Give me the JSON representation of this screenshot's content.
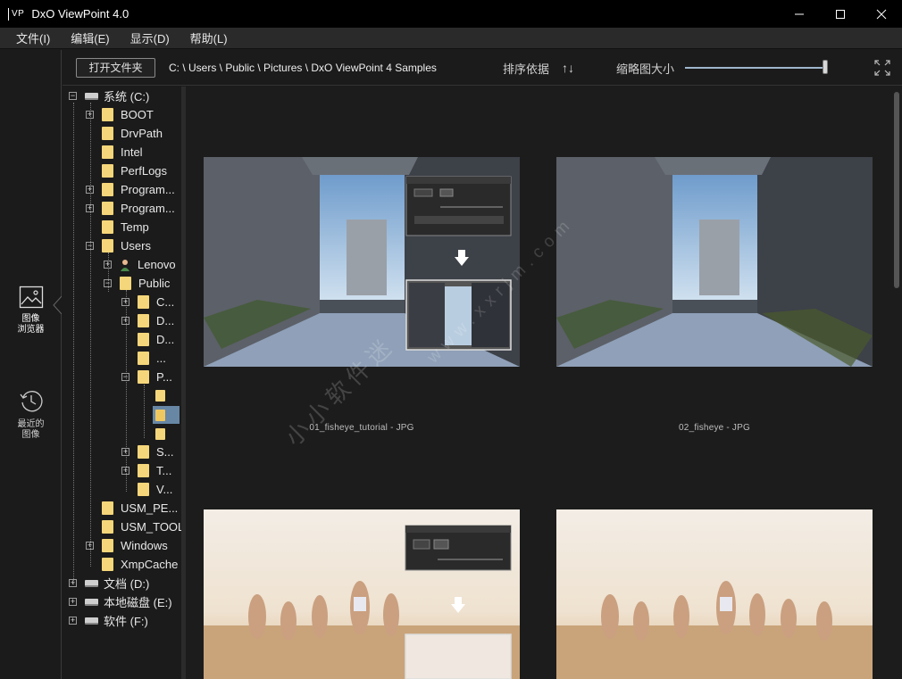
{
  "window": {
    "logo": "VP",
    "title": "DxO ViewPoint 4.0"
  },
  "menu": [
    "文件(I)",
    "编辑(E)",
    "显示(D)",
    "帮助(L)"
  ],
  "rail": {
    "browser_label_1": "图像",
    "browser_label_2": "浏览器",
    "recent_label_1": "最近的",
    "recent_label_2": "图像"
  },
  "toolbar": {
    "open_folder": "打开文件夹",
    "path": "C: \\ Users \\ Public \\ Pictures \\ DxO ViewPoint 4 Samples",
    "sort_label": "排序依据",
    "sort_icon": "↑↓",
    "thumb_size_label": "缩略图大小",
    "thumb_size_value": 1.0
  },
  "tree": {
    "root": "系统 (C:)",
    "items": [
      "BOOT",
      "DrvPath",
      "Intel",
      "PerfLogs",
      "Program...",
      "Program...",
      "Temp",
      "Users",
      "Lenovo",
      "Public",
      "C...",
      "D...",
      "D...",
      "...",
      "P...",
      "S...",
      "T...",
      "V...",
      "USM_PE...",
      "USM_TOOL",
      "Windows",
      "XmpCache"
    ],
    "drives": [
      "文档 (D:)",
      "本地磁盘 (E:)",
      "软件 (F:)"
    ]
  },
  "thumbs": [
    {
      "caption": "01_fisheye_tutorial - JPG"
    },
    {
      "caption": "02_fisheye - JPG"
    }
  ],
  "watermark": {
    "cn": "小小软件迷",
    "url": "www.xxrjm.com"
  },
  "colors": {
    "accent": "#9fb6cc",
    "selection": "#7aa3c8",
    "folder": "#f5d67a"
  }
}
